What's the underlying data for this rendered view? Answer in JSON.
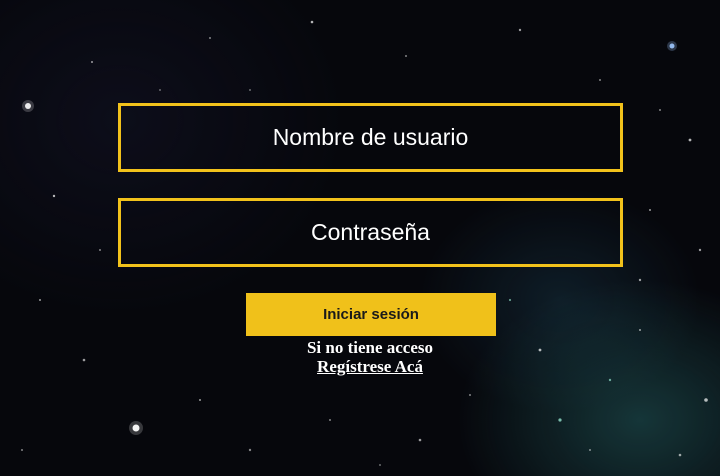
{
  "login_form": {
    "username_placeholder": "Nombre de usuario",
    "password_placeholder": "Contraseña",
    "login_button_label": "Iniciar sesión",
    "no_access_text": "Si no tiene acceso",
    "register_link_text": "Regístrese Acá"
  },
  "colors": {
    "accent": "#f2c21b",
    "background": "#06070c",
    "text": "#ffffff"
  }
}
